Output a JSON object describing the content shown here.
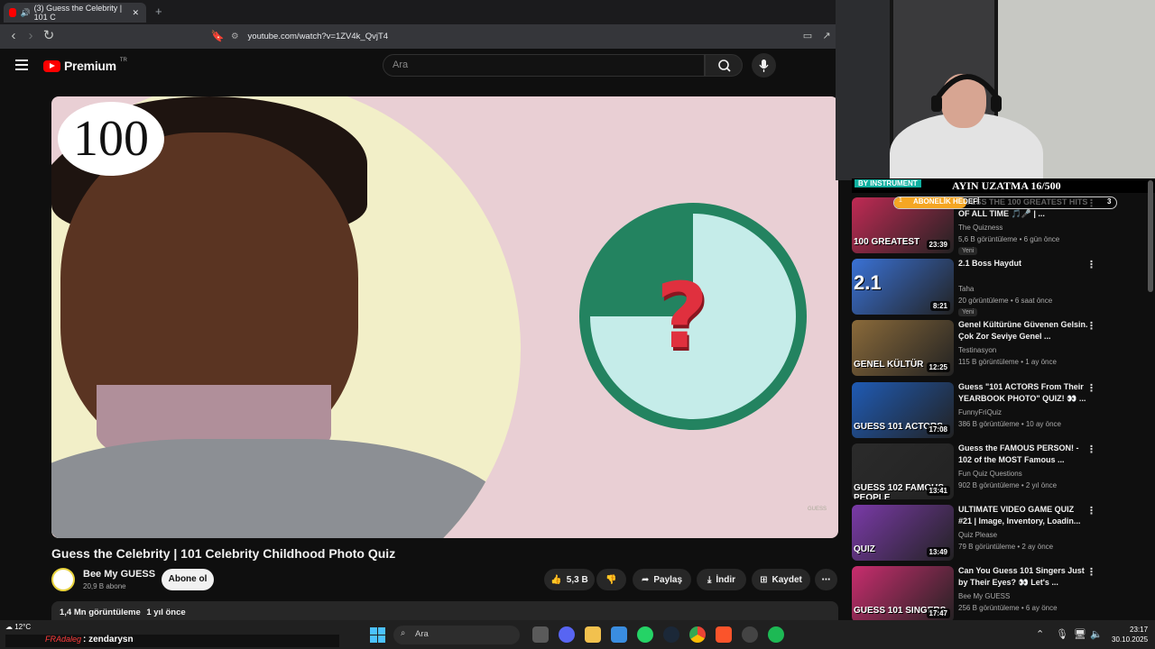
{
  "browser": {
    "tab_title": "(3) Guess the Celebrity | 101 C",
    "new_tab": "+",
    "url": "youtube.com/watch?v=1ZV4k_QvjT4"
  },
  "youtube": {
    "logo_text": "Premium",
    "logo_badge": "TR",
    "search_placeholder": "Ara"
  },
  "video": {
    "overlay_number": "100",
    "question_mark": "?",
    "timer_progress": 0.25,
    "watermark": "GUESS",
    "title": "Guess the Celebrity | 101 Celebrity Childhood Photo Quiz",
    "channel": "Bee My GUESS",
    "subscribers": "20,9 B abone",
    "subscribe_label": "Abone ol",
    "likes": "5,3 B",
    "share_label": "Paylaş",
    "download_label": "İndir",
    "save_label": "Kaydet",
    "views": "1,4 Mn görüntüleme",
    "age": "1 yıl önce"
  },
  "stream": {
    "banner_left": "BY INSTRUMENT",
    "banner_right": "AYIN UZATMA 16/500",
    "goal_label": "ABONELİK HEDEFİ",
    "goal_min": "1",
    "goal_max": "3"
  },
  "sidebar": [
    {
      "title": "GUESS THE 100 GREATEST HITS OF ALL TIME 🎵🎤 | ...",
      "channel": "The Quizness",
      "meta": "5,6 B görüntüleme • 6 gün önce",
      "badge": "Yeni",
      "duration": "23:39",
      "thumb_text": "100 GREATEST",
      "thumb_color": "#c02a54"
    },
    {
      "title": "2.1 Boss Haydut",
      "channel": "Taha",
      "meta": "20 görüntüleme • 6 saat önce",
      "badge": "Yeni",
      "duration": "8:21",
      "thumb_text": "2.1",
      "thumb_color": "#3a72d6"
    },
    {
      "title": "Genel Kültürüne Güvenen Gelsin. Çok Zor Seviye Genel ...",
      "channel": "Testinasyon",
      "meta": "115 B görüntüleme • 1 ay önce",
      "badge": "",
      "duration": "12:25",
      "thumb_text": "GENEL KÜLTÜR",
      "thumb_color": "#8a6a3a"
    },
    {
      "title": "Guess \"101 ACTORS From Their YEARBOOK PHOTO\" QUIZ! 👀 ...",
      "channel": "FunnyFriQuiz",
      "meta": "386 B görüntüleme • 10 ay önce",
      "badge": "",
      "duration": "17:08",
      "thumb_text": "GUESS 101 ACTORS",
      "thumb_color": "#1f5bb5"
    },
    {
      "title": "Guess the FAMOUS PERSON! - 102 of the MOST Famous ...",
      "channel": "Fun Quiz Questions",
      "meta": "902 B görüntüleme • 2 yıl önce",
      "badge": "",
      "duration": "13:41",
      "thumb_text": "GUESS 102 FAMOUS PEOPLE",
      "thumb_color": "#2b2b2b"
    },
    {
      "title": "ULTIMATE VIDEO GAME QUIZ #21 | Image, Inventory, Loadin...",
      "channel": "Quiz Please",
      "meta": "79 B görüntüleme • 2 ay önce",
      "badge": "",
      "duration": "13:49",
      "thumb_text": "QUIZ",
      "thumb_color": "#7a3aa8"
    },
    {
      "title": "Can You Guess 101 Singers Just by Their Eyes? 👀 Let's ...",
      "channel": "Bee My GUESS",
      "meta": "256 B görüntüleme • 6 ay önce",
      "badge": "",
      "duration": "17:47",
      "thumb_text": "GUESS 101 SINGERS",
      "thumb_color": "#c92d6e"
    }
  ],
  "taskbar": {
    "temperature": "12°C",
    "chat_user": "FRAdaleg",
    "chat_message": ": zendarysn",
    "search_label": "Ara",
    "time": "23:17",
    "date": "30.10.2025"
  }
}
